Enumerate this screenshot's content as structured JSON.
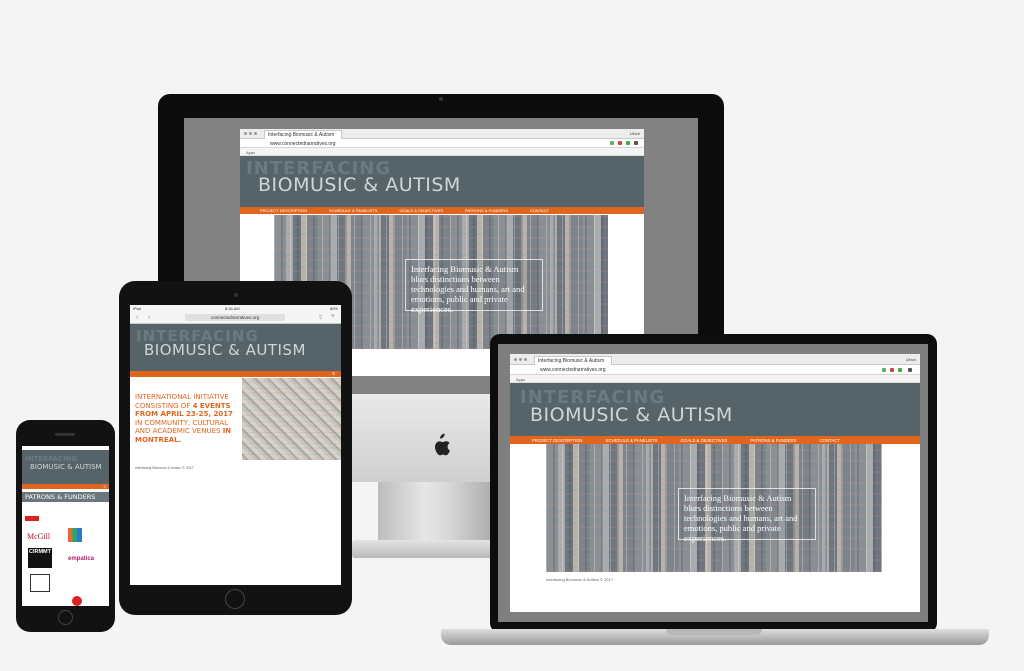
{
  "browser": {
    "tab_title": "Interfacing Biomusic & Autism",
    "url": "www.connectednarratives.org",
    "bookmarks_label": "Apps",
    "user_label": "Ulrich"
  },
  "site": {
    "title_top": "INTERFACING",
    "title_main": "BIOMUSIC & AUTISM",
    "nav": [
      "PROJECT DESCRIPTION",
      "SCHEDULE & PANELISTS",
      "GOALS & OBJECTIVES",
      "PATRONS & FUNDERS",
      "CONTACT"
    ],
    "quote": "Interfacing Biomusic & Autism blurs distinctions between technologies and humans, art and emotions, public and private experiences.",
    "footer": "Interfacing Biomusic & Autism © 2017",
    "colors": {
      "header": "#56646a",
      "nav": "#e1661d",
      "accent": "#e1661d"
    }
  },
  "ipad": {
    "status_left": "iPad",
    "time": "8:34 AM",
    "status_right": "80%",
    "url": "connectednarratives.org",
    "intro": {
      "p1": "INTERNATIONAL INITIATIVE CONSISTING OF ",
      "p2": "4 EVENTS FROM APRIL 23-25, 2017",
      "p3": " IN COMMUNITY, CULTURAL AND ACADEMIC VENUES ",
      "p4": "IN MONTREAL."
    },
    "menu_icon": "hamburger-icon"
  },
  "iphone": {
    "section_title": "PATRONS & FUNDERS",
    "logos": [
      "McGill",
      "CIRMMT",
      "empatica"
    ],
    "menu_icon": "hamburger-icon"
  }
}
